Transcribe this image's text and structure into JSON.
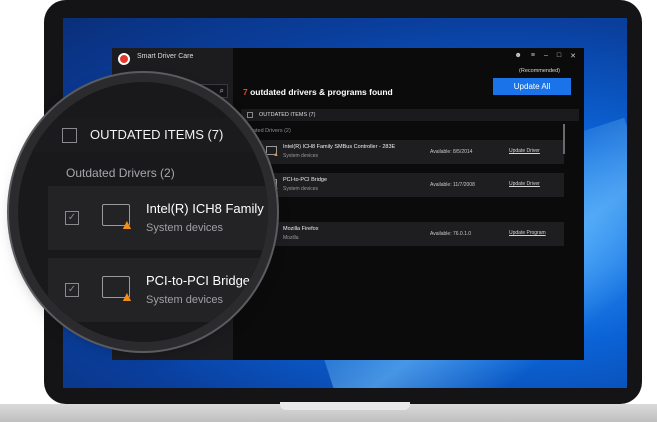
{
  "app": {
    "title": "Smart Driver Care",
    "window_controls": [
      "user",
      "menu",
      "minimize",
      "maximize",
      "close"
    ],
    "search": {
      "placeholder": "",
      "icon": "search-icon"
    }
  },
  "summary": {
    "count": "7",
    "text": " outdated drivers & programs found"
  },
  "update": {
    "recommended": "(Recommended)",
    "button": "Update All"
  },
  "list": {
    "header": "OUTDATED ITEMS  (7)",
    "drivers_section": "Outdated Drivers  (2)",
    "programs_section": "Programs  (5)",
    "drivers": [
      {
        "name": "Intel(R) ICH8 Family SMBus Controller - 283E",
        "category": "System devices",
        "available": "Available: 8/5/2014",
        "action": "Update Driver"
      },
      {
        "name": "PCI-to-PCI Bridge",
        "category": "System devices",
        "available": "Available: 11/7/2008",
        "action": "Update Driver"
      }
    ],
    "programs": [
      {
        "name": "Mozilla Firefox",
        "category": "Mozilla",
        "available": "Available: 76.0.1.0",
        "action": "Update Program"
      }
    ]
  },
  "magnifier": {
    "header": "OUTDATED ITEMS  (7)",
    "section": "Outdated Drivers  (2)",
    "rows": [
      {
        "name": "Intel(R) ICH8 Family",
        "category": "System devices"
      },
      {
        "name": "PCI-to-PCI Bridge",
        "category": "System devices"
      }
    ]
  },
  "colors": {
    "accent": "#1a73e8",
    "count": "#e8412f",
    "warning": "#f28c1c"
  }
}
